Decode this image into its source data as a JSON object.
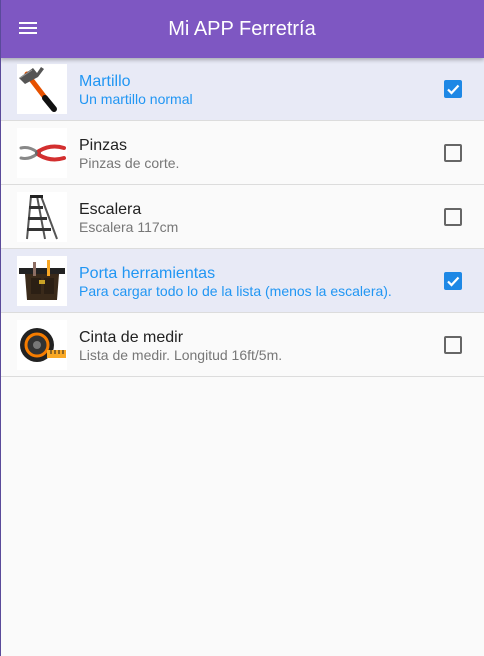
{
  "appbar": {
    "title": "Mi APP Ferretría",
    "menu_icon": "menu-icon",
    "color": "#7e57c2"
  },
  "accent_color": "#2196f3",
  "items": [
    {
      "title": "Martillo",
      "subtitle": "Un martillo normal",
      "checked": true,
      "icon": "hammer-icon"
    },
    {
      "title": "Pinzas",
      "subtitle": "Pinzas de corte.",
      "checked": false,
      "icon": "pliers-icon"
    },
    {
      "title": "Escalera",
      "subtitle": "Escalera 117cm",
      "checked": false,
      "icon": "ladder-icon"
    },
    {
      "title": "Porta herramientas",
      "subtitle": "Para cargar todo lo de la lista (menos la escalera).",
      "checked": true,
      "icon": "tool-belt-icon"
    },
    {
      "title": "Cinta de medir",
      "subtitle": "Lista de medir. Longitud 16ft/5m.",
      "checked": false,
      "icon": "tape-measure-icon"
    }
  ]
}
